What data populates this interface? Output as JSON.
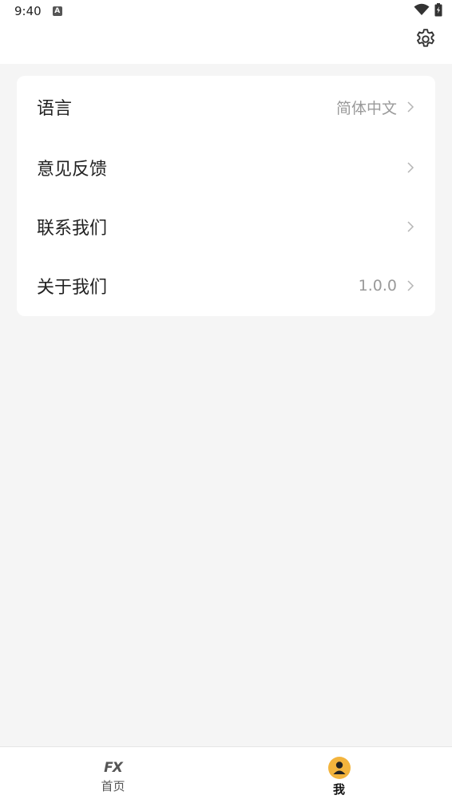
{
  "status_bar": {
    "time": "9:40",
    "notification_icon": "a-icon",
    "wifi_icon": "wifi-icon",
    "battery_icon": "battery-charging-icon"
  },
  "header": {
    "settings_icon": "gear-icon"
  },
  "settings_list": [
    {
      "label": "语言",
      "value": "简体中文"
    },
    {
      "label": "意见反馈",
      "value": ""
    },
    {
      "label": "联系我们",
      "value": ""
    },
    {
      "label": "关于我们",
      "value": "1.0.0"
    }
  ],
  "bottom_nav": {
    "home": {
      "icon_text": "FX",
      "label": "首页",
      "active": false
    },
    "me": {
      "icon": "user-avatar-icon",
      "label": "我",
      "active": true
    }
  },
  "colors": {
    "page_background": "#f5f5f5",
    "card_background": "#ffffff",
    "avatar_accent": "#f3b43d"
  }
}
